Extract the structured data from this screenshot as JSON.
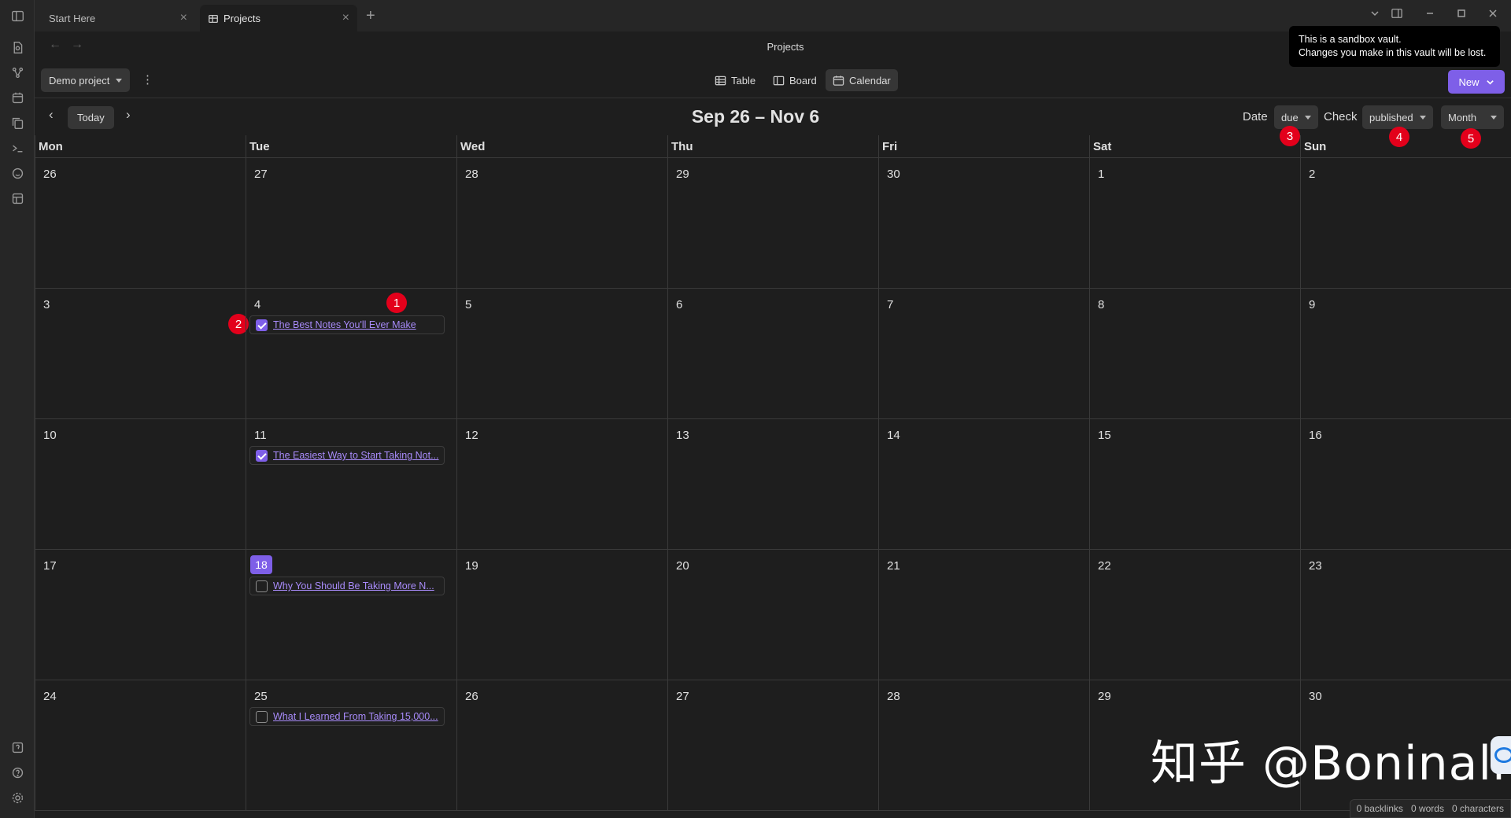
{
  "tabs": [
    {
      "label": "Start Here",
      "active": false
    },
    {
      "label": "Projects",
      "active": true
    }
  ],
  "view_title": "Projects",
  "tooltip": {
    "line1": "This is a sandbox vault.",
    "line2": "Changes you make in this vault will be lost."
  },
  "toolbar": {
    "base_select": "Demo project",
    "views": [
      "Table",
      "Board",
      "Calendar"
    ],
    "active_view": "Calendar",
    "new_label": "New"
  },
  "calendar": {
    "today_label": "Today",
    "range_title": "Sep 26 – Nov 6",
    "date_label": "Date",
    "date_field": "due",
    "check_label": "Check",
    "check_field": "published",
    "mode": "Month",
    "weekdays": [
      "Mon",
      "Tue",
      "Wed",
      "Thu",
      "Fri",
      "Sat",
      "Sun"
    ],
    "weeks": [
      [
        "26",
        "27",
        "28",
        "29",
        "30",
        "1",
        "2"
      ],
      [
        "3",
        "4",
        "5",
        "6",
        "7",
        "8",
        "9"
      ],
      [
        "10",
        "11",
        "12",
        "13",
        "14",
        "15",
        "16"
      ],
      [
        "17",
        "18",
        "19",
        "20",
        "21",
        "22",
        "23"
      ],
      [
        "24",
        "25",
        "26",
        "27",
        "28",
        "29",
        "30"
      ]
    ],
    "today": {
      "week": 3,
      "day": 1
    },
    "events": [
      {
        "week": 1,
        "day": 1,
        "title": "The Best Notes You'll Ever Make",
        "checked": true
      },
      {
        "week": 2,
        "day": 1,
        "title": "The Easiest Way to Start Taking Not...",
        "checked": true
      },
      {
        "week": 3,
        "day": 1,
        "title": "Why You Should Be Taking More N...",
        "checked": false
      },
      {
        "week": 4,
        "day": 1,
        "title": "What I Learned From Taking 15,000...",
        "checked": false
      }
    ]
  },
  "badges": [
    "1",
    "2",
    "3",
    "4",
    "5"
  ],
  "status": {
    "backlinks": "0 backlinks",
    "words": "0 words",
    "characters": "0 characters"
  },
  "watermark": "知乎 @Boninall",
  "colors": {
    "accent": "#7e5fe8",
    "link": "#a88bfa",
    "badge": "#e3001b",
    "background": "#1e1e1e"
  }
}
